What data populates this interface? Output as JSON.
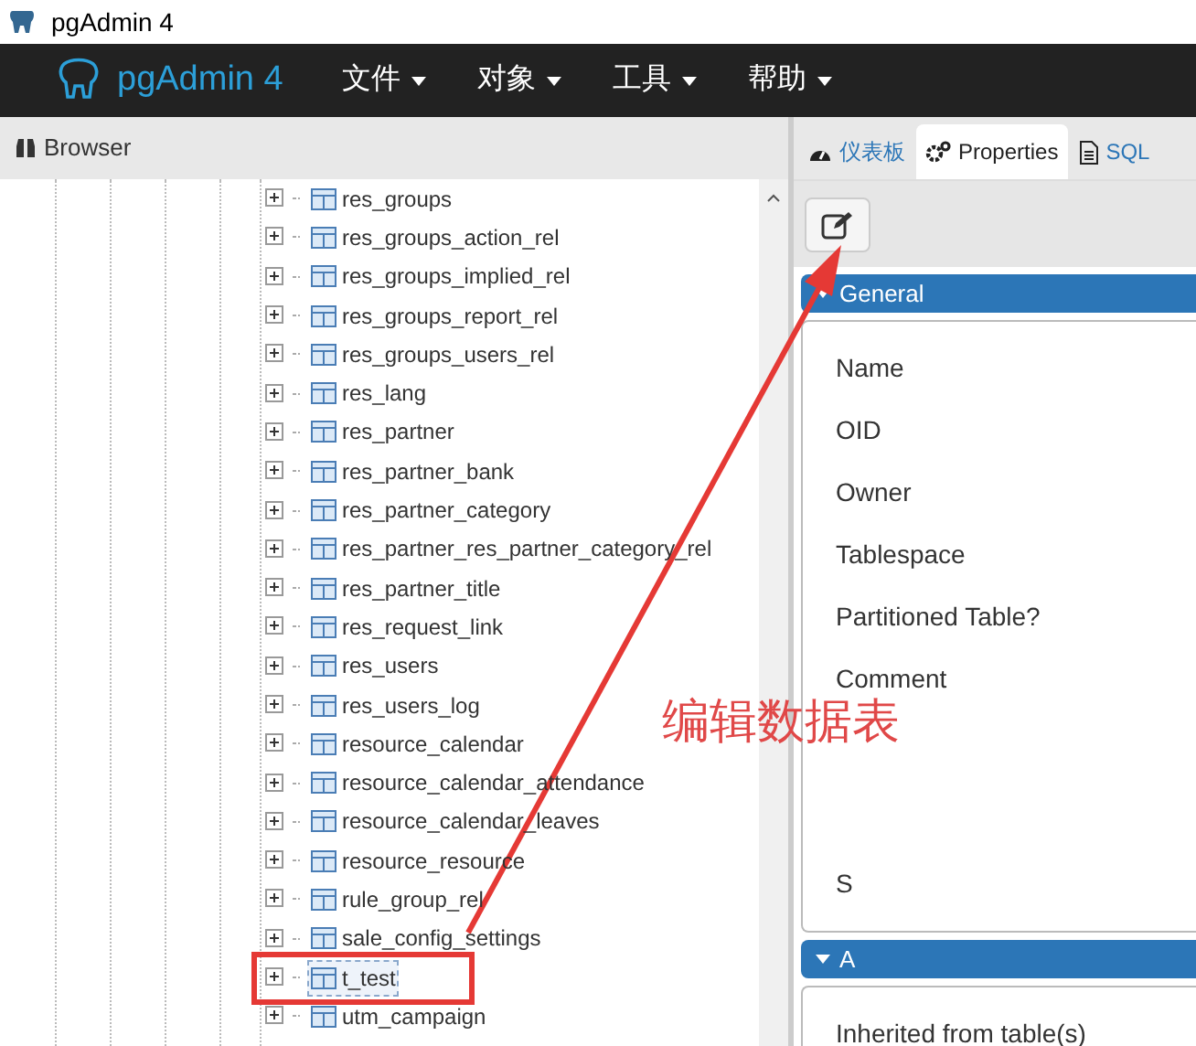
{
  "window": {
    "title": "pgAdmin 4"
  },
  "navbar": {
    "brand": "pgAdmin 4",
    "menus": [
      {
        "label": "文件"
      },
      {
        "label": "对象"
      },
      {
        "label": "工具"
      },
      {
        "label": "帮助"
      }
    ]
  },
  "browser": {
    "title": "Browser",
    "tree": [
      {
        "label": "res_groups",
        "selected": false
      },
      {
        "label": "res_groups_action_rel",
        "selected": false
      },
      {
        "label": "res_groups_implied_rel",
        "selected": false
      },
      {
        "label": "res_groups_report_rel",
        "selected": false
      },
      {
        "label": "res_groups_users_rel",
        "selected": false
      },
      {
        "label": "res_lang",
        "selected": false
      },
      {
        "label": "res_partner",
        "selected": false
      },
      {
        "label": "res_partner_bank",
        "selected": false
      },
      {
        "label": "res_partner_category",
        "selected": false
      },
      {
        "label": "res_partner_res_partner_category_rel",
        "selected": false
      },
      {
        "label": "res_partner_title",
        "selected": false
      },
      {
        "label": "res_request_link",
        "selected": false
      },
      {
        "label": "res_users",
        "selected": false
      },
      {
        "label": "res_users_log",
        "selected": false
      },
      {
        "label": "resource_calendar",
        "selected": false
      },
      {
        "label": "resource_calendar_attendance",
        "selected": false
      },
      {
        "label": "resource_calendar_leaves",
        "selected": false
      },
      {
        "label": "resource_resource",
        "selected": false
      },
      {
        "label": "rule_group_rel",
        "selected": false
      },
      {
        "label": "sale_config_settings",
        "selected": false
      },
      {
        "label": "t_test",
        "selected": true
      },
      {
        "label": "utm_campaign",
        "selected": false
      }
    ]
  },
  "properties": {
    "tabs": [
      {
        "kind": "dashboard",
        "label": "仪表板",
        "selected": false
      },
      {
        "kind": "properties",
        "label": "Properties",
        "selected": true
      },
      {
        "kind": "sql",
        "label": "SQL",
        "selected": false
      }
    ],
    "sections": [
      {
        "title": "General",
        "expanded": true,
        "fields": [
          "Name",
          "OID",
          "Owner",
          "Tablespace",
          "Partitioned Table?",
          "Comment",
          "S"
        ]
      },
      {
        "title": "A",
        "expanded": true,
        "fields": [
          "Inherited from table(s)"
        ]
      }
    ]
  },
  "annotation": {
    "text": "编辑数据表"
  }
}
